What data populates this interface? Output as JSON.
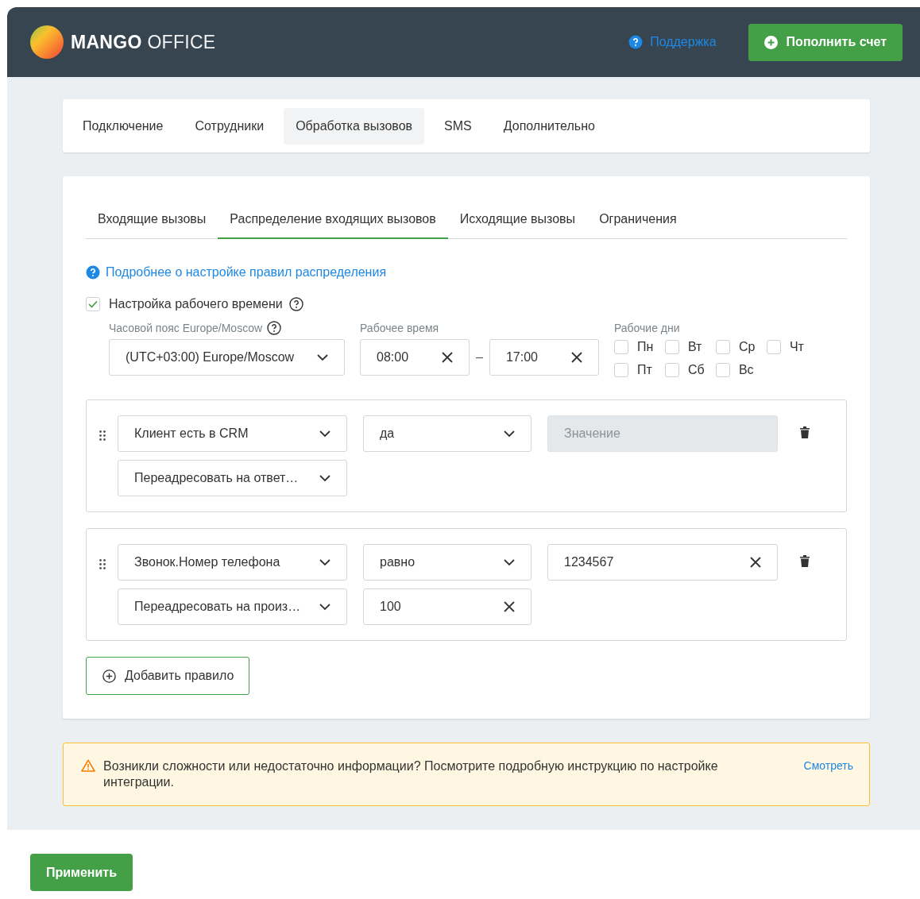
{
  "header": {
    "logo": {
      "bold": "MANGO",
      "light": "OFFICE"
    },
    "support_link": "Поддержка",
    "topup_button": "Пополнить счет"
  },
  "top_tabs": [
    {
      "label": "Подключение",
      "selected": false
    },
    {
      "label": "Сотрудники",
      "selected": false
    },
    {
      "label": "Обработка вызовов",
      "selected": true
    },
    {
      "label": "SMS",
      "selected": false
    },
    {
      "label": "Дополнительно",
      "selected": false
    }
  ],
  "sub_tabs": [
    {
      "label": "Входящие вызовы",
      "selected": false
    },
    {
      "label": "Распределение входящих вызовов",
      "selected": true
    },
    {
      "label": "Исходящие вызовы",
      "selected": false
    },
    {
      "label": "Ограничения",
      "selected": false
    }
  ],
  "help_link": "Подробнее о настройке правил распределения",
  "work_time": {
    "checked": true,
    "label": "Настройка рабочего времени",
    "timezone_label": "Часовой пояс Europe/Moscow",
    "timezone_value": "(UTC+03:00) Europe/Moscow",
    "time_label": "Рабочее время",
    "from": "08:00",
    "separator": "–",
    "to": "17:00",
    "days_label": "Рабочие дни",
    "days": [
      {
        "label": "Пн",
        "checked": false
      },
      {
        "label": "Вт",
        "checked": false
      },
      {
        "label": "Ср",
        "checked": false
      },
      {
        "label": "Чт",
        "checked": false
      },
      {
        "label": "Пт",
        "checked": false
      },
      {
        "label": "Сб",
        "checked": false
      },
      {
        "label": "Вс",
        "checked": false
      }
    ]
  },
  "rules": [
    {
      "field": "Клиент есть в CRM",
      "operator": "да",
      "value": {
        "kind": "disabled",
        "placeholder": "Значение"
      },
      "action": "Переадресовать на ответ…"
    },
    {
      "field": "Звонок.Номер телефона",
      "operator": "равно",
      "value": {
        "kind": "text",
        "value": "1234567"
      },
      "action": "Переадресовать на произ…",
      "action_value": "100"
    }
  ],
  "add_button": "Добавить правило",
  "notice": {
    "text": "Возникли сложности или недостаточно информации? Посмотрите подробную инструкцию по настройке интеграции.",
    "link": "Смотреть"
  },
  "apply_button": "Применить"
}
